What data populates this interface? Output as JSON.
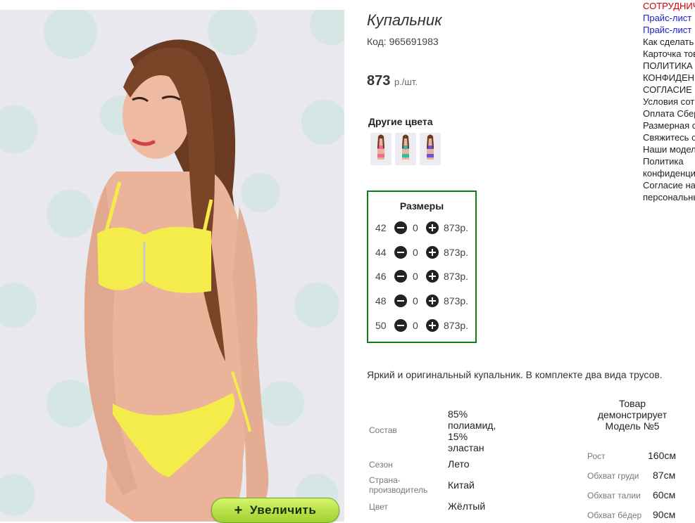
{
  "product": {
    "title": "Купальник",
    "code": "Код: 965691983",
    "price": "873",
    "price_unit": "р./шт.",
    "zoom_button": "Увеличить",
    "zoom_icon": "+"
  },
  "other_colors": {
    "heading": "Другие цвета",
    "swatches": [
      {
        "name": "pink",
        "color": "#f06c8c"
      },
      {
        "name": "green",
        "color": "#2bbf9a"
      },
      {
        "name": "violet",
        "color": "#6a55d8"
      }
    ]
  },
  "sizes": {
    "heading": "Размеры",
    "rows": [
      {
        "size": "42",
        "qty": "0",
        "price": "873р."
      },
      {
        "size": "44",
        "qty": "0",
        "price": "873р."
      },
      {
        "size": "46",
        "qty": "0",
        "price": "873р."
      },
      {
        "size": "48",
        "qty": "0",
        "price": "873р."
      },
      {
        "size": "50",
        "qty": "0",
        "price": "873р."
      }
    ]
  },
  "description": "Яркий и оригинальный купальник. В комплекте два вида трусов.",
  "specs": {
    "composition_label": "Состав",
    "composition_lines": [
      "85%",
      "полиамид,",
      "15%",
      "эластан"
    ],
    "season_label": "Сезон",
    "season": "Лето",
    "country_label_1": "Страна-",
    "country_label_2": "производитель",
    "country": "Китай",
    "color_label": "Цвет",
    "color": "Жёлтый"
  },
  "model": {
    "title_lines": [
      "Товар",
      "демонстрирует",
      "Модель №5"
    ],
    "height_label": "Рост",
    "height": "160см",
    "chest_label": "Обхват груди",
    "chest": "87см",
    "waist_label": "Обхват талии",
    "waist": "60см",
    "hips_label": "Обхват бёдер",
    "hips": "90см"
  },
  "side_links": [
    {
      "text": "СОТРУДНИЧЕСТВО",
      "style": "red"
    },
    {
      "text": "Прайс-лист",
      "style": "blue"
    },
    {
      "text": "Прайс-лист",
      "style": "blue"
    },
    {
      "text": "Как сделать заказ",
      "style": "dark"
    },
    {
      "text": "Карточка товара",
      "style": "dark"
    },
    {
      "text": "ПОЛИТИКА",
      "style": "dark"
    },
    {
      "text": "КОНФИДЕНЦИАЛЬНОСТИ",
      "style": "dark"
    },
    {
      "text": "СОГЛАСИЕ",
      "style": "dark"
    },
    {
      "text": "Условия сотрудничества",
      "style": "dark"
    },
    {
      "text": "Оплата Сбербанк",
      "style": "dark"
    },
    {
      "text": "Размерная сетка",
      "style": "dark"
    },
    {
      "text": "Свяжитесь с нами",
      "style": "dark"
    },
    {
      "text": "Наши модели",
      "style": "dark"
    },
    {
      "text": "Политика",
      "style": "dark"
    },
    {
      "text": "конфиденциальности",
      "style": "dark"
    },
    {
      "text": "Согласие на обработку",
      "style": "dark"
    },
    {
      "text": "персональных данных",
      "style": "dark"
    }
  ],
  "colors": {
    "swimsuit": "#f3ec4a",
    "border_green": "#0b7f12",
    "link_red": "#d00000",
    "link_blue": "#1a22c7"
  }
}
